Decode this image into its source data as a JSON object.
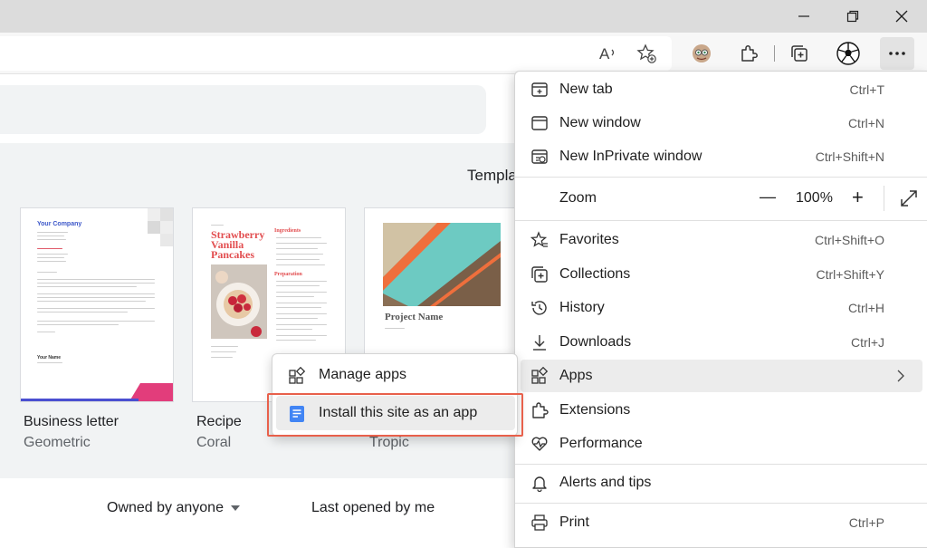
{
  "docs": {
    "template_gallery_label": "Templa",
    "templates": [
      {
        "name": "Business letter",
        "subtitle": "Geometric"
      },
      {
        "name": "Recipe",
        "subtitle": "Coral"
      },
      {
        "name": "",
        "subtitle": "Tropic"
      }
    ],
    "thumb_letter": {
      "company": "Your Company",
      "signature": "Your Name"
    },
    "thumb_recipe": {
      "title_lines": [
        "Strawberry",
        "Vanilla",
        "Pancakes"
      ],
      "ingredients_heading": "Ingredients",
      "preparation_heading": "Preparation"
    },
    "thumb_tropic": {
      "project_name": "Project Name"
    },
    "filters": {
      "owner": "Owned by anyone",
      "opened": "Last opened by me"
    }
  },
  "menu": {
    "items": [
      {
        "label": "New tab",
        "shortcut": "Ctrl+T",
        "icon": "new-tab-icon"
      },
      {
        "label": "New window",
        "shortcut": "Ctrl+N",
        "icon": "new-window-icon"
      },
      {
        "label": "New InPrivate window",
        "shortcut": "Ctrl+Shift+N",
        "icon": "inprivate-icon"
      },
      {
        "label": "Zoom",
        "shortcut": "",
        "icon": ""
      },
      {
        "label": "Favorites",
        "shortcut": "Ctrl+Shift+O",
        "icon": "favorites-icon"
      },
      {
        "label": "Collections",
        "shortcut": "Ctrl+Shift+Y",
        "icon": "collections-icon"
      },
      {
        "label": "History",
        "shortcut": "Ctrl+H",
        "icon": "history-icon"
      },
      {
        "label": "Downloads",
        "shortcut": "Ctrl+J",
        "icon": "downloads-icon"
      },
      {
        "label": "Apps",
        "shortcut": "",
        "icon": "apps-icon"
      },
      {
        "label": "Extensions",
        "shortcut": "",
        "icon": "extensions-icon"
      },
      {
        "label": "Performance",
        "shortcut": "",
        "icon": "performance-icon"
      },
      {
        "label": "Alerts and tips",
        "shortcut": "",
        "icon": "bell-icon"
      },
      {
        "label": "Print",
        "shortcut": "Ctrl+P",
        "icon": "print-icon"
      }
    ],
    "zoom": {
      "minus": "—",
      "value": "100%",
      "plus": "+"
    }
  },
  "apps_submenu": {
    "items": [
      {
        "label": "Manage apps",
        "icon": "manage-apps-icon"
      },
      {
        "label": "Install this site as an app",
        "icon": "docs-app-icon"
      }
    ]
  },
  "colors": {
    "accent_red": "#e8604b",
    "docs_blue": "#4285f4",
    "highlight": "#ececec"
  }
}
